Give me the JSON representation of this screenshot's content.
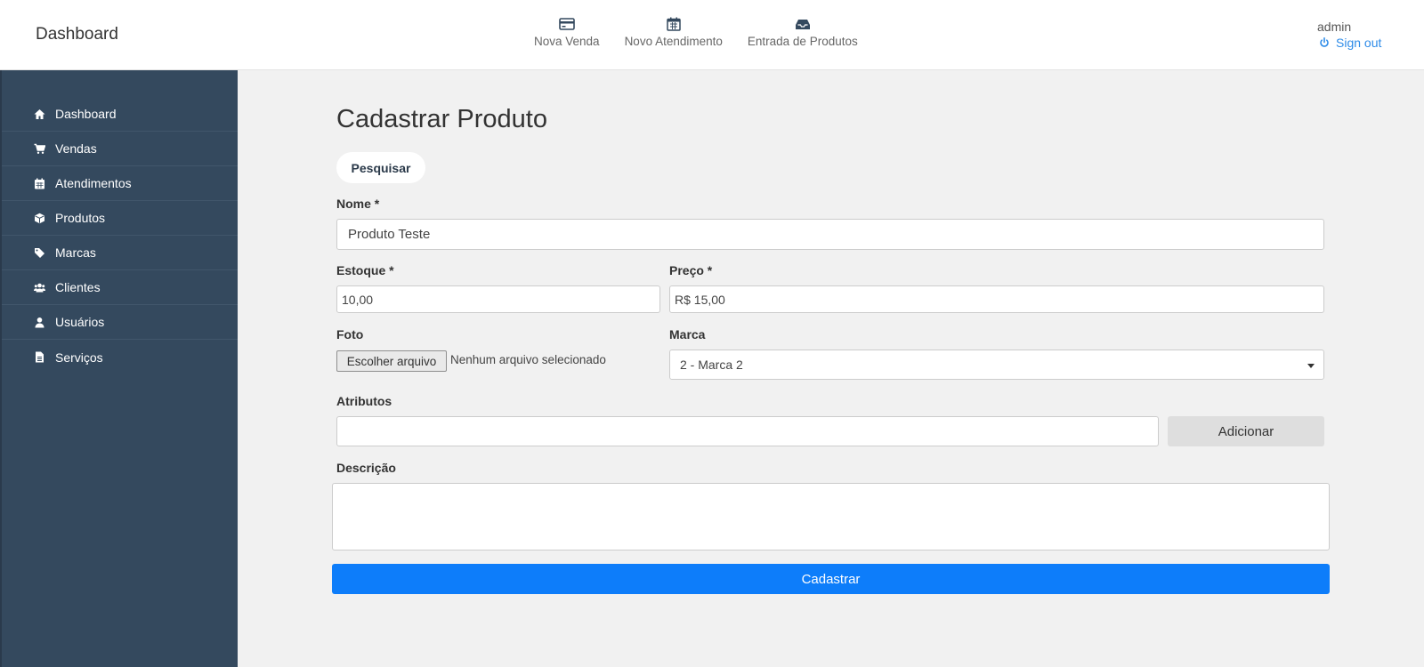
{
  "header": {
    "brand": "Dashboard",
    "nav": [
      {
        "label": "Nova Venda",
        "icon": "credit-card-icon"
      },
      {
        "label": "Novo Atendimento",
        "icon": "calendar-icon"
      },
      {
        "label": "Entrada de Produtos",
        "icon": "inbox-icon"
      }
    ],
    "user": {
      "name": "admin",
      "signout_label": "Sign out",
      "signout_icon": "power-icon"
    }
  },
  "sidebar": {
    "items": [
      {
        "label": "Dashboard",
        "icon": "home-icon"
      },
      {
        "label": "Vendas",
        "icon": "cart-icon"
      },
      {
        "label": "Atendimentos",
        "icon": "calendar-icon"
      },
      {
        "label": "Produtos",
        "icon": "cube-icon"
      },
      {
        "label": "Marcas",
        "icon": "tag-icon"
      },
      {
        "label": "Clientes",
        "icon": "users-icon"
      },
      {
        "label": "Usuários",
        "icon": "user-icon"
      },
      {
        "label": "Serviços",
        "icon": "file-icon"
      }
    ]
  },
  "main": {
    "title": "Cadastrar Produto",
    "search_button": "Pesquisar",
    "form": {
      "nome": {
        "label": "Nome *",
        "value": "Produto Teste"
      },
      "estoque": {
        "label": "Estoque *",
        "value": "10,00"
      },
      "preco": {
        "label": "Preço *",
        "value": "R$ 15,00"
      },
      "foto": {
        "label": "Foto",
        "button": "Escolher arquivo",
        "status": "Nenhum arquivo selecionado"
      },
      "marca": {
        "label": "Marca",
        "selected": "2 - Marca 2"
      },
      "atributos": {
        "label": "Atributos",
        "value": "",
        "add_button": "Adicionar"
      },
      "descricao": {
        "label": "Descrição",
        "value": ""
      },
      "submit": "Cadastrar"
    }
  },
  "colors": {
    "sidebar_bg": "#34495e",
    "primary": "#0d7dfa",
    "link": "#2f8ce8",
    "content_bg": "#f1f1f1"
  }
}
